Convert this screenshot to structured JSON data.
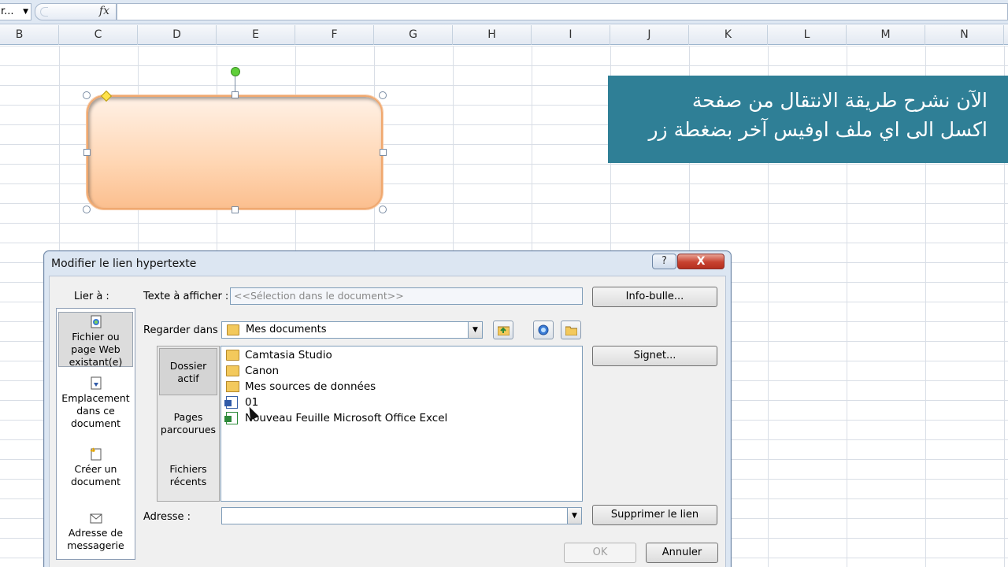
{
  "formula_bar": {
    "name_box": "r...",
    "fx": "fx",
    "formula": ""
  },
  "columns": [
    "B",
    "C",
    "D",
    "E",
    "F",
    "G",
    "H",
    "I",
    "J",
    "K",
    "L",
    "M",
    "N"
  ],
  "caption": {
    "line1": "الآن نشرح طريقة الانتقال من صفحة",
    "line2": "اكسل الى اي ملف اوفيس آخر بضغطة زر"
  },
  "dialog": {
    "title": "Modifier le lien hypertexte",
    "help": "?",
    "close": "X",
    "link_to_label": "Lier à :",
    "link_to": [
      {
        "label": "Fichier ou page Web existant(e)",
        "icon": "file-web-icon"
      },
      {
        "label": "Emplacement dans ce document",
        "icon": "document-place-icon"
      },
      {
        "label": "Créer un document",
        "icon": "new-document-icon"
      },
      {
        "label": "Adresse de messagerie",
        "icon": "email-icon"
      }
    ],
    "text_to_display_label": "Texte à afficher :",
    "text_to_display_value": "<<Sélection dans le document>>",
    "screentip_button": "Info-bulle...",
    "look_in_label": "Regarder dans :",
    "look_in_value": "Mes documents",
    "places": [
      "Dossier actif",
      "Pages parcourues",
      "Fichiers récents"
    ],
    "files": [
      {
        "name": "Camtasia Studio",
        "icon": "folder"
      },
      {
        "name": "Canon",
        "icon": "folder"
      },
      {
        "name": "Mes sources de données",
        "icon": "datasrc"
      },
      {
        "name": "01",
        "icon": "word"
      },
      {
        "name": "Nouveau Feuille Microsoft Office Excel",
        "icon": "excel"
      }
    ],
    "bookmark_button": "Signet...",
    "address_label": "Adresse :",
    "address_value": "",
    "remove_link_button": "Supprimer le lien",
    "ok_button": "OK",
    "cancel_button": "Annuler"
  }
}
